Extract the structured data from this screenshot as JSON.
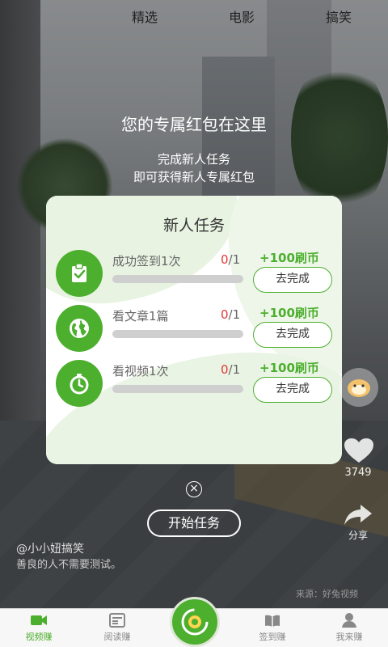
{
  "top_tabs": [
    "精选",
    "电影",
    "搞笑"
  ],
  "promo": {
    "title": "您的专属红包在这里",
    "line1": "完成新人任务",
    "line2": "即可获得新人专属红包"
  },
  "modal": {
    "title": "新人任务",
    "tasks": [
      {
        "icon": "clipboard-check-icon",
        "name": "成功签到1次",
        "current": "0",
        "total": "/1",
        "progress": 0,
        "reward": "+100刷币",
        "button": "去完成"
      },
      {
        "icon": "globe-icon",
        "name": "看文章1篇",
        "current": "0",
        "total": "/1",
        "progress": 0,
        "reward": "+100刷币",
        "button": "去完成"
      },
      {
        "icon": "stopwatch-icon",
        "name": "看视频1次",
        "current": "0",
        "total": "/1",
        "progress": 0,
        "reward": "+100刷币",
        "button": "去完成"
      }
    ],
    "start_button": "开始任务"
  },
  "side": {
    "likes": "3749",
    "share": "分享"
  },
  "video": {
    "author": "@小小妞搞笑",
    "caption": "善良的人不需要测试。",
    "source": "来源：好兔视频"
  },
  "bottom_nav": [
    {
      "label": "视频赚",
      "icon": "video-icon",
      "active": true
    },
    {
      "label": "阅读赚",
      "icon": "news-icon",
      "active": false
    },
    {
      "label": "签到赚",
      "icon": "book-icon",
      "active": false
    },
    {
      "label": "我来赚",
      "icon": "user-icon",
      "active": false
    }
  ],
  "colors": {
    "accent": "#4caf2e",
    "progress_current": "#e53935"
  }
}
